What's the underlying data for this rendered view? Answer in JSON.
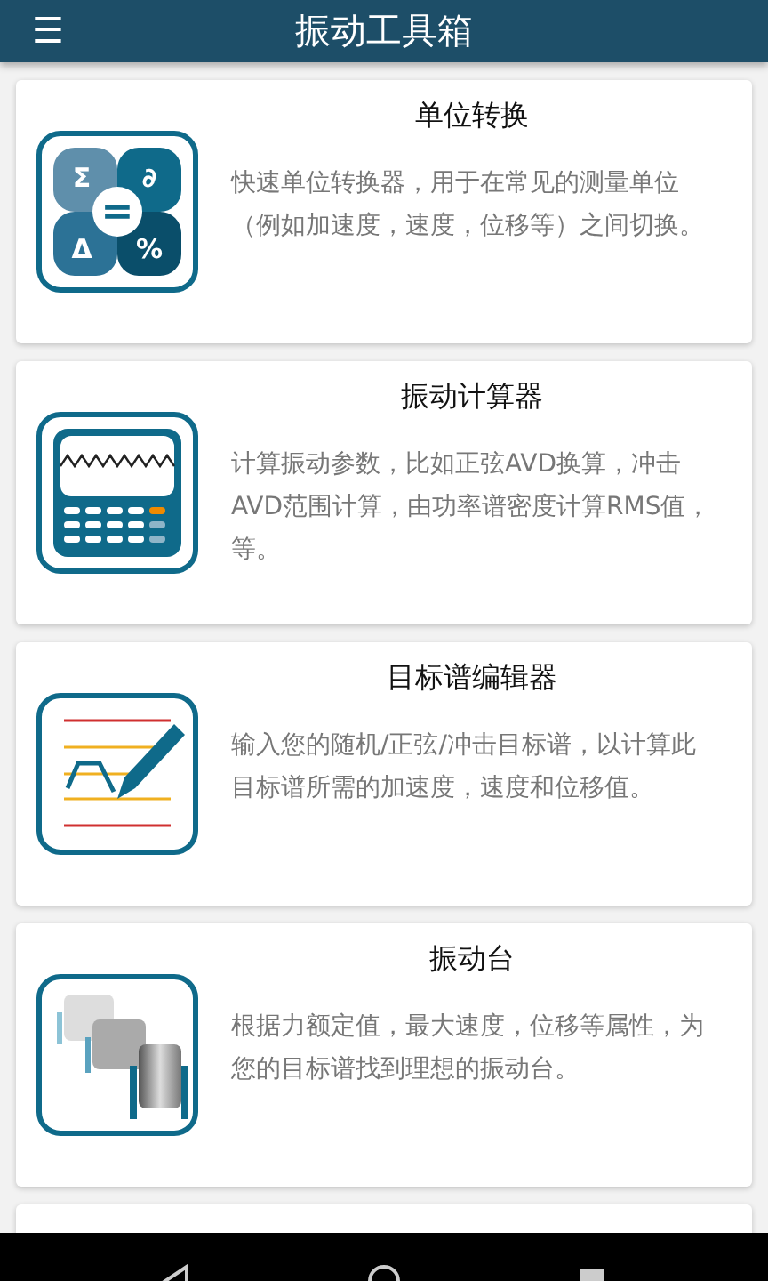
{
  "app_bar": {
    "menu": "☰",
    "title": "振动工具箱"
  },
  "cards": [
    {
      "kind": "converter",
      "title": "单位转换",
      "description": "快速单位转换器，用于在常见的测量单位（例如加速度，速度，位移等）之间切换。",
      "symbols": [
        "Σ",
        "∂",
        "Δ",
        "%",
        "="
      ]
    },
    {
      "kind": "calculator",
      "title": "振动计算器",
      "description": "计算振动参数，比如正弦AVD换算，冲击AVD范围计算，由功率谱密度计算RMS值，等。"
    },
    {
      "kind": "spectrum",
      "title": "目标谱编辑器",
      "description": "输入您的随机/正弦/冲击目标谱，以计算此目标谱所需的加速度，速度和位移值。"
    },
    {
      "kind": "shaker",
      "title": "振动台",
      "description": "根据力额定值，最大速度，位移等属性，为您的目标谱找到理想的振动台。"
    },
    {
      "kind": "none"
    }
  ]
}
